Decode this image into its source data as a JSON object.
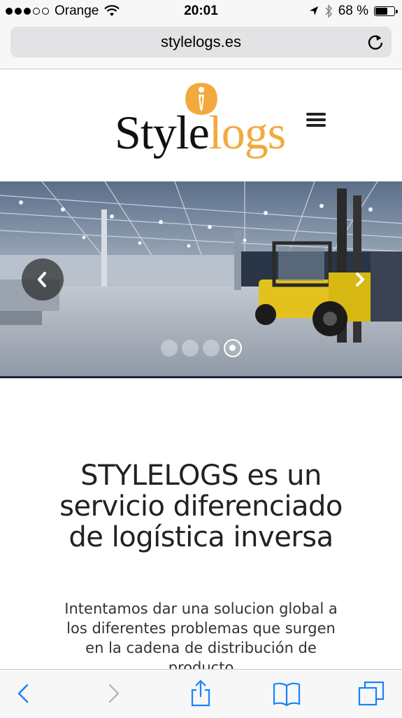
{
  "status_bar": {
    "carrier": "Orange",
    "time": "20:01",
    "battery_percent": "68 %",
    "battery_level": 0.68,
    "signal_bars_filled": 3,
    "signal_bars_total": 5
  },
  "browser": {
    "url": "stylelogs.es"
  },
  "site": {
    "logo_part1": "Style",
    "logo_part2": "logs",
    "brand_color": "#f2aa3e"
  },
  "carousel": {
    "slides_total": 4,
    "active_slide": 4,
    "prev_icon": "chevron-left-icon",
    "next_icon": "chevron-right-icon"
  },
  "main": {
    "headline": "STYLELOGS es un servicio diferenciado de logística inversa",
    "paragraph": "Intentamos dar una solucion global a los diferentes problemas que surgen en la cadena de distribución de producto"
  },
  "toolbar": {
    "accent": "#1a82fb",
    "items": [
      "back-icon",
      "forward-icon",
      "share-icon",
      "bookmarks-icon",
      "tabs-icon"
    ]
  }
}
